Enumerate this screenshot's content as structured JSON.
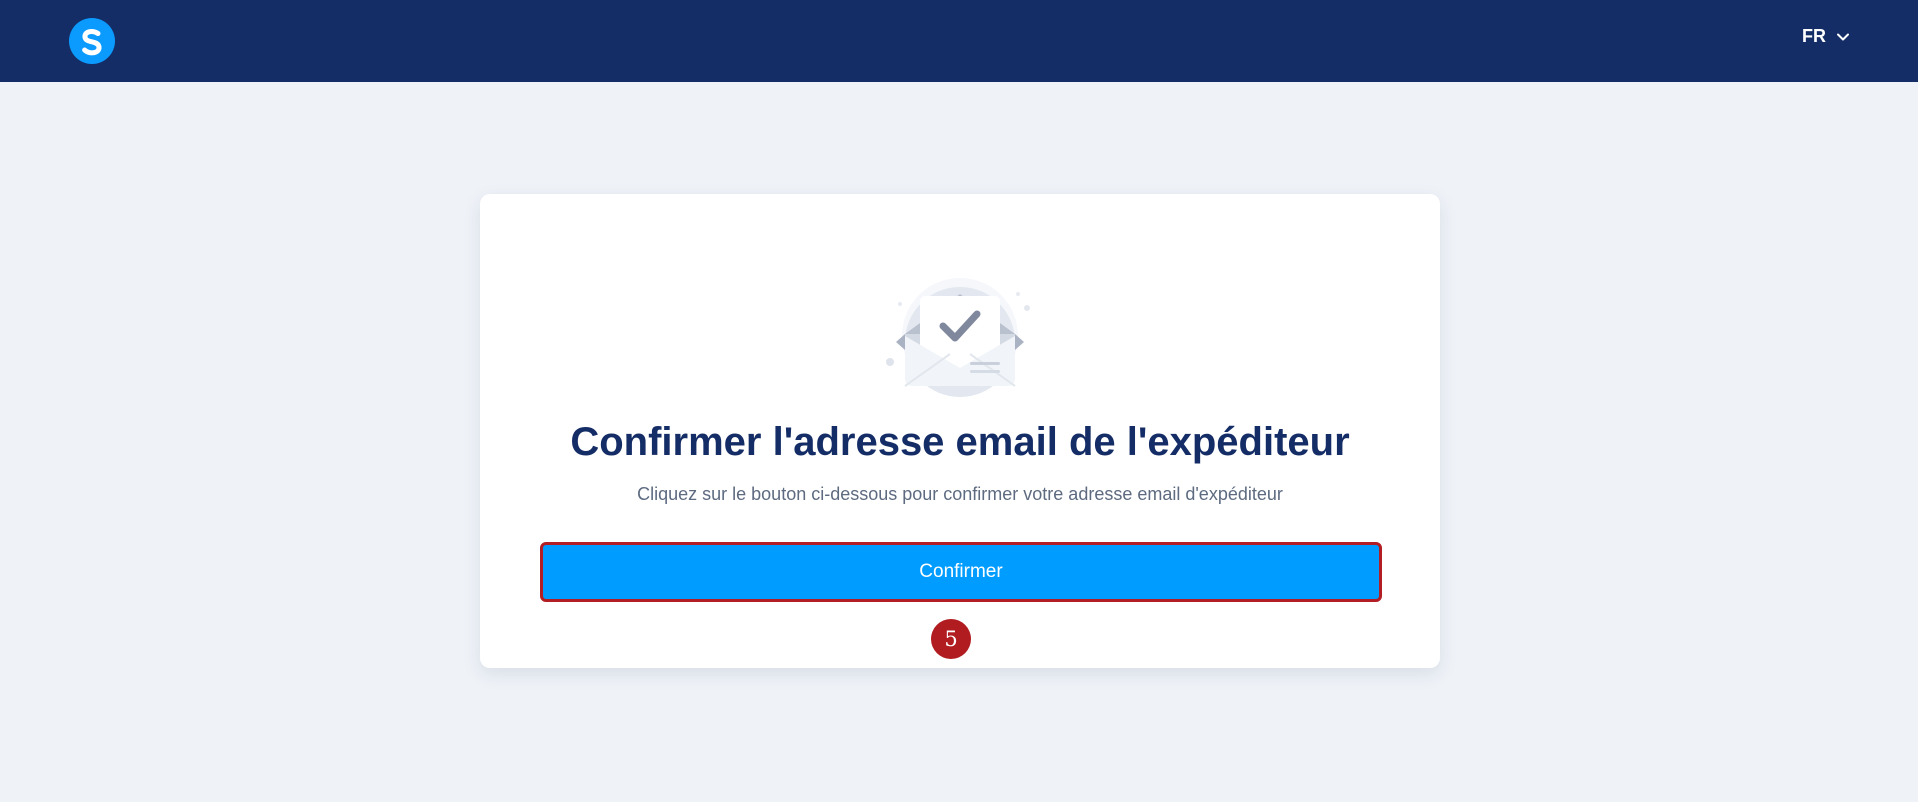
{
  "header": {
    "logo_letter": "S",
    "language": "FR",
    "colors": {
      "background": "#152d66",
      "logo": "#0b9bff"
    }
  },
  "card": {
    "illustration_icon": "envelope-check-icon",
    "title": "Confirmer l'adresse email de l'expéditeur",
    "subtitle": "Cliquez sur le bouton ci-dessous pour confirmer votre adresse email d'expéditeur",
    "button_label": "Confirmer",
    "colors": {
      "title": "#152d66",
      "button": "#009cff",
      "highlight_border": "#b21e24"
    }
  },
  "annotation": {
    "step_number": "5",
    "color": "#b01c20"
  },
  "page": {
    "background": "#eff3f8"
  }
}
